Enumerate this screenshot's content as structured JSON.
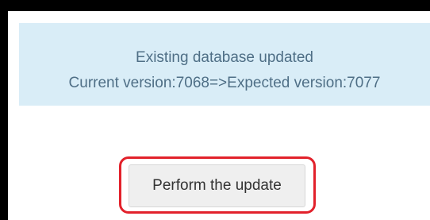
{
  "notice": {
    "line1": "Existing database updated",
    "line2": "Current version:7068=>Expected version:7077",
    "background_color": "#d9edf7",
    "text_color": "#4f6f86"
  },
  "action": {
    "button_label": "Perform the update",
    "highlight_color": "#e2212b"
  }
}
